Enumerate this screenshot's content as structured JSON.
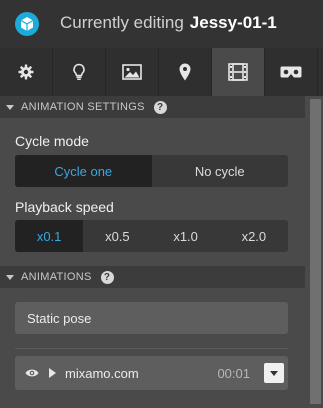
{
  "header": {
    "prefix": "Currently editing",
    "model_name": "Jessy-01-1"
  },
  "tabs": [
    {
      "icon": "gear-icon",
      "active": false
    },
    {
      "icon": "lightbulb-icon",
      "active": false
    },
    {
      "icon": "image-icon",
      "active": false
    },
    {
      "icon": "map-pin-icon",
      "active": false
    },
    {
      "icon": "film-icon",
      "active": true
    },
    {
      "icon": "vr-headset-icon",
      "active": false
    }
  ],
  "animation_settings": {
    "title": "ANIMATION SETTINGS",
    "help": "?",
    "cycle_mode": {
      "label": "Cycle mode",
      "options": [
        "Cycle one",
        "No cycle"
      ],
      "selected": "Cycle one"
    },
    "playback_speed": {
      "label": "Playback speed",
      "options": [
        "x0.1",
        "x0.5",
        "x1.0",
        "x2.0"
      ],
      "selected": "x0.1"
    }
  },
  "animations": {
    "title": "ANIMATIONS",
    "help": "?",
    "static_pose_label": "Static pose",
    "items": [
      {
        "name": "mixamo.com",
        "duration": "00:01"
      }
    ]
  },
  "colors": {
    "accent": "#3aa8e0",
    "header_bg": "#333333",
    "panel_bg": "#4a4a4a"
  }
}
